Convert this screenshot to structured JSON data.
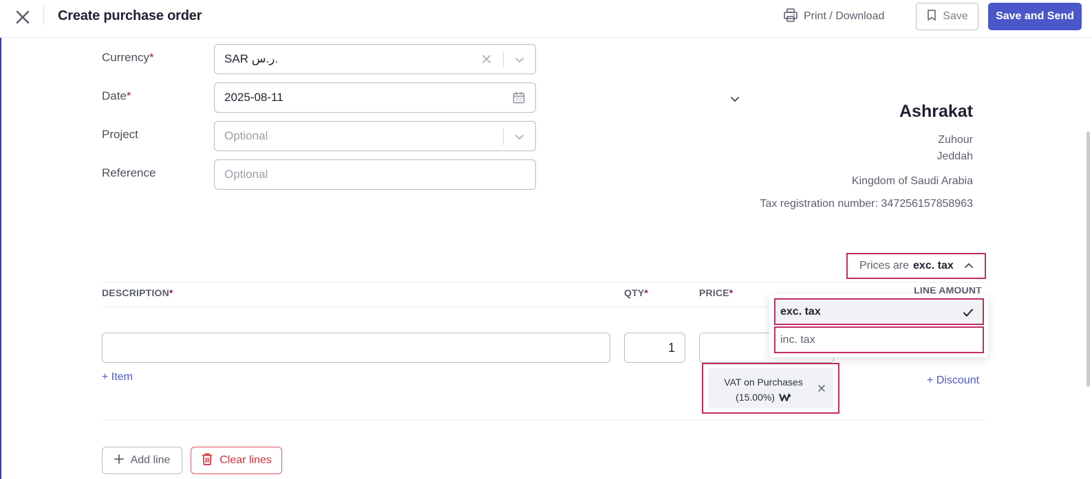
{
  "header": {
    "title": "Create purchase order",
    "print_label": "Print / Download",
    "save_label": "Save",
    "save_send_label": "Save and Send"
  },
  "form": {
    "currency": {
      "label": "Currency",
      "required_mark": "*",
      "value": "SAR ر.س."
    },
    "date": {
      "label": "Date",
      "required_mark": "*",
      "value": "2025-08-11"
    },
    "project": {
      "label": "Project",
      "placeholder": "Optional"
    },
    "reference": {
      "label": "Reference",
      "placeholder": "Optional"
    }
  },
  "contact": {
    "name": "Ashrakat",
    "address_line1": "Zuhour",
    "city": "Jeddah",
    "country": "Kingdom of Saudi Arabia",
    "tax_registration": "Tax registration number: 347256157858963"
  },
  "prices_toggle": {
    "prefix": "Prices are",
    "value": "exc. tax",
    "options": [
      {
        "label": "exc. tax",
        "selected": true
      },
      {
        "label": "inc. tax",
        "selected": false
      }
    ]
  },
  "table": {
    "columns": {
      "description": "DESCRIPTION",
      "qty": "QTY",
      "price": "PRICE",
      "line_amount": "LINE AMOUNT",
      "required_mark": "*"
    },
    "row": {
      "description": "",
      "qty": "1",
      "price": "",
      "tax_chip": "VAT on Purchases (15.00%)"
    },
    "add_item_link": "+ Item",
    "discount_link": "+ Discount"
  },
  "actions": {
    "add_line": "Add line",
    "clear_lines": "Clear lines"
  },
  "colors": {
    "primary": "#4a57c9",
    "highlight_border": "#c22b63",
    "danger": "#d2303d",
    "required": "#8a1a6a"
  }
}
